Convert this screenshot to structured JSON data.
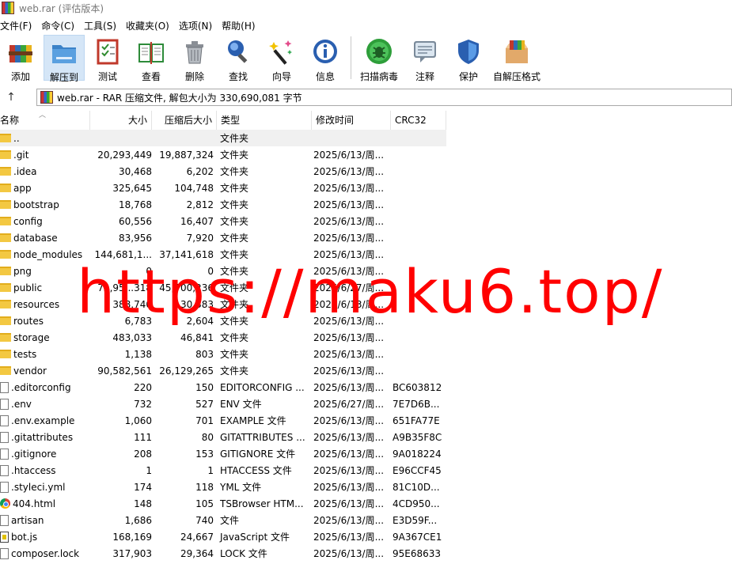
{
  "window": {
    "title": "web.rar (评估版本)"
  },
  "menu": [
    "文件(F)",
    "命令(C)",
    "工具(S)",
    "收藏夹(O)",
    "选项(N)",
    "帮助(H)"
  ],
  "toolbar": {
    "items": [
      {
        "label": "添加",
        "icon": "add-icon"
      },
      {
        "label": "解压到",
        "icon": "extract-to-icon"
      },
      {
        "label": "测试",
        "icon": "test-icon"
      },
      {
        "label": "查看",
        "icon": "view-icon"
      },
      {
        "label": "删除",
        "icon": "delete-icon"
      },
      {
        "label": "查找",
        "icon": "find-icon"
      },
      {
        "label": "向导",
        "icon": "wizard-icon"
      },
      {
        "label": "信息",
        "icon": "info-icon"
      }
    ],
    "items2": [
      {
        "label": "扫描病毒",
        "icon": "virus-scan-icon"
      },
      {
        "label": "注释",
        "icon": "comment-icon"
      },
      {
        "label": "保护",
        "icon": "protect-icon"
      },
      {
        "label": "自解压格式",
        "icon": "sfx-icon"
      }
    ]
  },
  "address": {
    "up": "↑",
    "path": "web.rar - RAR 压缩文件, 解包大小为 330,690,081 字节"
  },
  "columns": {
    "name": "名称",
    "size": "大小",
    "packed": "压缩后大小",
    "type": "类型",
    "modified": "修改时间",
    "crc": "CRC32"
  },
  "rows": [
    {
      "name": "..",
      "size": "",
      "packed": "",
      "type": "文件夹",
      "modified": "",
      "crc": "",
      "kind": "folder"
    },
    {
      "name": ".git",
      "size": "20,293,449",
      "packed": "19,887,324",
      "type": "文件夹",
      "modified": "2025/6/13/周...",
      "crc": "",
      "kind": "folder"
    },
    {
      "name": ".idea",
      "size": "30,468",
      "packed": "6,202",
      "type": "文件夹",
      "modified": "2025/6/13/周...",
      "crc": "",
      "kind": "folder"
    },
    {
      "name": "app",
      "size": "325,645",
      "packed": "104,748",
      "type": "文件夹",
      "modified": "2025/6/13/周...",
      "crc": "",
      "kind": "folder"
    },
    {
      "name": "bootstrap",
      "size": "18,768",
      "packed": "2,812",
      "type": "文件夹",
      "modified": "2025/6/13/周...",
      "crc": "",
      "kind": "folder"
    },
    {
      "name": "config",
      "size": "60,556",
      "packed": "16,407",
      "type": "文件夹",
      "modified": "2025/6/13/周...",
      "crc": "",
      "kind": "folder"
    },
    {
      "name": "database",
      "size": "83,956",
      "packed": "7,920",
      "type": "文件夹",
      "modified": "2025/6/13/周...",
      "crc": "",
      "kind": "folder"
    },
    {
      "name": "node_modules",
      "size": "144,681,1...",
      "packed": "37,141,618",
      "type": "文件夹",
      "modified": "2025/6/13/周...",
      "crc": "",
      "kind": "folder"
    },
    {
      "name": "png",
      "size": "0",
      "packed": "0",
      "type": "文件夹",
      "modified": "2025/6/13/周...",
      "crc": "",
      "kind": "folder"
    },
    {
      "name": "public",
      "size": "72,95...318",
      "packed": "45,700,236",
      "type": "文件夹",
      "modified": "2025/6/27/周...",
      "crc": "",
      "kind": "folder"
    },
    {
      "name": "resources",
      "size": "388,740",
      "packed": "130,383",
      "type": "文件夹",
      "modified": "2025/6/13/周...",
      "crc": "",
      "kind": "folder"
    },
    {
      "name": "routes",
      "size": "6,783",
      "packed": "2,604",
      "type": "文件夹",
      "modified": "2025/6/13/周...",
      "crc": "",
      "kind": "folder"
    },
    {
      "name": "storage",
      "size": "483,033",
      "packed": "46,841",
      "type": "文件夹",
      "modified": "2025/6/13/周...",
      "crc": "",
      "kind": "folder"
    },
    {
      "name": "tests",
      "size": "1,138",
      "packed": "803",
      "type": "文件夹",
      "modified": "2025/6/13/周...",
      "crc": "",
      "kind": "folder"
    },
    {
      "name": "vendor",
      "size": "90,582,561",
      "packed": "26,129,265",
      "type": "文件夹",
      "modified": "2025/6/13/周...",
      "crc": "",
      "kind": "folder"
    },
    {
      "name": ".editorconfig",
      "size": "220",
      "packed": "150",
      "type": "EDITORCONFIG ...",
      "modified": "2025/6/13/周...",
      "crc": "BC603812",
      "kind": "doc"
    },
    {
      "name": ".env",
      "size": "732",
      "packed": "527",
      "type": "ENV 文件",
      "modified": "2025/6/27/周...",
      "crc": "7E7D6B...",
      "kind": "doc"
    },
    {
      "name": ".env.example",
      "size": "1,060",
      "packed": "701",
      "type": "EXAMPLE 文件",
      "modified": "2025/6/13/周...",
      "crc": "651FA77E",
      "kind": "doc"
    },
    {
      "name": ".gitattributes",
      "size": "111",
      "packed": "80",
      "type": "GITATTRIBUTES ...",
      "modified": "2025/6/13/周...",
      "crc": "A9B35F8C",
      "kind": "doc"
    },
    {
      "name": ".gitignore",
      "size": "208",
      "packed": "153",
      "type": "GITIGNORE 文件",
      "modified": "2025/6/13/周...",
      "crc": "9A018224",
      "kind": "doc"
    },
    {
      "name": ".htaccess",
      "size": "1",
      "packed": "1",
      "type": "HTACCESS 文件",
      "modified": "2025/6/13/周...",
      "crc": "E96CCF45",
      "kind": "doc"
    },
    {
      "name": ".styleci.yml",
      "size": "174",
      "packed": "118",
      "type": "YML 文件",
      "modified": "2025/6/13/周...",
      "crc": "81C10D...",
      "kind": "doc"
    },
    {
      "name": "404.html",
      "size": "148",
      "packed": "105",
      "type": "TSBrowser HTM...",
      "modified": "2025/6/13/周...",
      "crc": "4CD950...",
      "kind": "chrome"
    },
    {
      "name": "artisan",
      "size": "1,686",
      "packed": "740",
      "type": "文件",
      "modified": "2025/6/13/周...",
      "crc": "E3D59F...",
      "kind": "doc"
    },
    {
      "name": "bot.js",
      "size": "168,169",
      "packed": "24,667",
      "type": "JavaScript 文件",
      "modified": "2025/6/13/周...",
      "crc": "9A367CE1",
      "kind": "js"
    },
    {
      "name": "composer.lock",
      "size": "317,903",
      "packed": "29,364",
      "type": "LOCK 文件",
      "modified": "2025/6/13/周...",
      "crc": "95E68633",
      "kind": "doc"
    }
  ],
  "watermark": "https://maku6.top/"
}
